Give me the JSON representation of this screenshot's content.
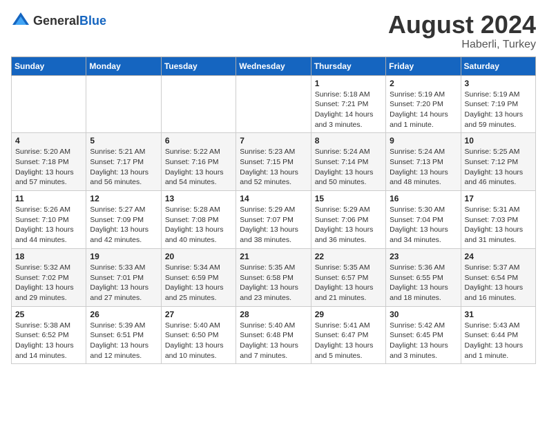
{
  "logo": {
    "text_general": "General",
    "text_blue": "Blue"
  },
  "header": {
    "month_year": "August 2024",
    "location": "Haberli, Turkey"
  },
  "weekdays": [
    "Sunday",
    "Monday",
    "Tuesday",
    "Wednesday",
    "Thursday",
    "Friday",
    "Saturday"
  ],
  "weeks": [
    [
      {
        "day": "",
        "info": ""
      },
      {
        "day": "",
        "info": ""
      },
      {
        "day": "",
        "info": ""
      },
      {
        "day": "",
        "info": ""
      },
      {
        "day": "1",
        "info": "Sunrise: 5:18 AM\nSunset: 7:21 PM\nDaylight: 14 hours\nand 3 minutes."
      },
      {
        "day": "2",
        "info": "Sunrise: 5:19 AM\nSunset: 7:20 PM\nDaylight: 14 hours\nand 1 minute."
      },
      {
        "day": "3",
        "info": "Sunrise: 5:19 AM\nSunset: 7:19 PM\nDaylight: 13 hours\nand 59 minutes."
      }
    ],
    [
      {
        "day": "4",
        "info": "Sunrise: 5:20 AM\nSunset: 7:18 PM\nDaylight: 13 hours\nand 57 minutes."
      },
      {
        "day": "5",
        "info": "Sunrise: 5:21 AM\nSunset: 7:17 PM\nDaylight: 13 hours\nand 56 minutes."
      },
      {
        "day": "6",
        "info": "Sunrise: 5:22 AM\nSunset: 7:16 PM\nDaylight: 13 hours\nand 54 minutes."
      },
      {
        "day": "7",
        "info": "Sunrise: 5:23 AM\nSunset: 7:15 PM\nDaylight: 13 hours\nand 52 minutes."
      },
      {
        "day": "8",
        "info": "Sunrise: 5:24 AM\nSunset: 7:14 PM\nDaylight: 13 hours\nand 50 minutes."
      },
      {
        "day": "9",
        "info": "Sunrise: 5:24 AM\nSunset: 7:13 PM\nDaylight: 13 hours\nand 48 minutes."
      },
      {
        "day": "10",
        "info": "Sunrise: 5:25 AM\nSunset: 7:12 PM\nDaylight: 13 hours\nand 46 minutes."
      }
    ],
    [
      {
        "day": "11",
        "info": "Sunrise: 5:26 AM\nSunset: 7:10 PM\nDaylight: 13 hours\nand 44 minutes."
      },
      {
        "day": "12",
        "info": "Sunrise: 5:27 AM\nSunset: 7:09 PM\nDaylight: 13 hours\nand 42 minutes."
      },
      {
        "day": "13",
        "info": "Sunrise: 5:28 AM\nSunset: 7:08 PM\nDaylight: 13 hours\nand 40 minutes."
      },
      {
        "day": "14",
        "info": "Sunrise: 5:29 AM\nSunset: 7:07 PM\nDaylight: 13 hours\nand 38 minutes."
      },
      {
        "day": "15",
        "info": "Sunrise: 5:29 AM\nSunset: 7:06 PM\nDaylight: 13 hours\nand 36 minutes."
      },
      {
        "day": "16",
        "info": "Sunrise: 5:30 AM\nSunset: 7:04 PM\nDaylight: 13 hours\nand 34 minutes."
      },
      {
        "day": "17",
        "info": "Sunrise: 5:31 AM\nSunset: 7:03 PM\nDaylight: 13 hours\nand 31 minutes."
      }
    ],
    [
      {
        "day": "18",
        "info": "Sunrise: 5:32 AM\nSunset: 7:02 PM\nDaylight: 13 hours\nand 29 minutes."
      },
      {
        "day": "19",
        "info": "Sunrise: 5:33 AM\nSunset: 7:01 PM\nDaylight: 13 hours\nand 27 minutes."
      },
      {
        "day": "20",
        "info": "Sunrise: 5:34 AM\nSunset: 6:59 PM\nDaylight: 13 hours\nand 25 minutes."
      },
      {
        "day": "21",
        "info": "Sunrise: 5:35 AM\nSunset: 6:58 PM\nDaylight: 13 hours\nand 23 minutes."
      },
      {
        "day": "22",
        "info": "Sunrise: 5:35 AM\nSunset: 6:57 PM\nDaylight: 13 hours\nand 21 minutes."
      },
      {
        "day": "23",
        "info": "Sunrise: 5:36 AM\nSunset: 6:55 PM\nDaylight: 13 hours\nand 18 minutes."
      },
      {
        "day": "24",
        "info": "Sunrise: 5:37 AM\nSunset: 6:54 PM\nDaylight: 13 hours\nand 16 minutes."
      }
    ],
    [
      {
        "day": "25",
        "info": "Sunrise: 5:38 AM\nSunset: 6:52 PM\nDaylight: 13 hours\nand 14 minutes."
      },
      {
        "day": "26",
        "info": "Sunrise: 5:39 AM\nSunset: 6:51 PM\nDaylight: 13 hours\nand 12 minutes."
      },
      {
        "day": "27",
        "info": "Sunrise: 5:40 AM\nSunset: 6:50 PM\nDaylight: 13 hours\nand 10 minutes."
      },
      {
        "day": "28",
        "info": "Sunrise: 5:40 AM\nSunset: 6:48 PM\nDaylight: 13 hours\nand 7 minutes."
      },
      {
        "day": "29",
        "info": "Sunrise: 5:41 AM\nSunset: 6:47 PM\nDaylight: 13 hours\nand 5 minutes."
      },
      {
        "day": "30",
        "info": "Sunrise: 5:42 AM\nSunset: 6:45 PM\nDaylight: 13 hours\nand 3 minutes."
      },
      {
        "day": "31",
        "info": "Sunrise: 5:43 AM\nSunset: 6:44 PM\nDaylight: 13 hours\nand 1 minute."
      }
    ]
  ]
}
